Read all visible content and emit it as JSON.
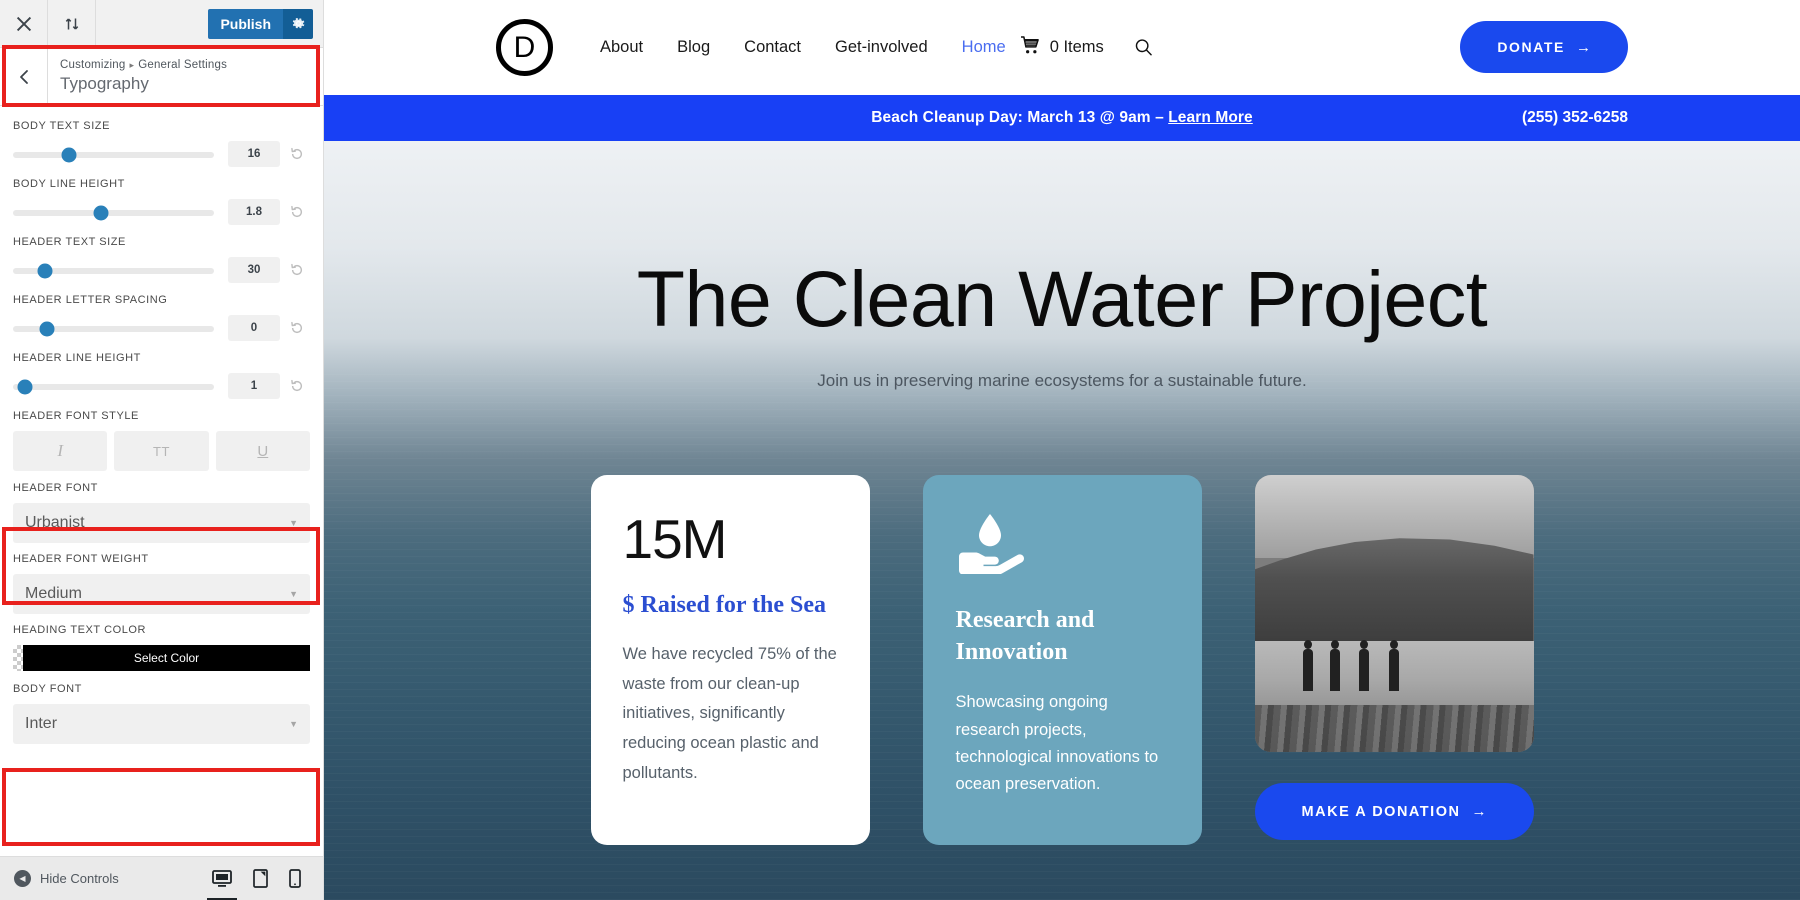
{
  "customizer": {
    "topbar": {
      "close_icon": "close-icon",
      "devices_icon": "collapse-expand-icon",
      "publish_label": "Publish",
      "gear_icon": "gear-icon"
    },
    "panel": {
      "back_icon": "chevron-left-icon",
      "breadcrumb_root": "Customizing",
      "breadcrumb_sep": "▸",
      "breadcrumb_parent": "General Settings",
      "title": "Typography"
    },
    "sliders": [
      {
        "label": "Body Text Size",
        "value": "16",
        "percent": 28
      },
      {
        "label": "Body Line Height",
        "value": "1.8",
        "percent": 44
      },
      {
        "label": "Header Text Size",
        "value": "30",
        "percent": 16
      },
      {
        "label": "Header Letter Spacing",
        "value": "0",
        "percent": 17
      },
      {
        "label": "Header Line Height",
        "value": "1",
        "percent": 6
      }
    ],
    "reset_icon": "reset-icon",
    "font_style": {
      "label": "Header Font Style",
      "buttons": [
        {
          "name": "italic-button",
          "glyph": "I"
        },
        {
          "name": "uppercase-button",
          "glyph": "TT"
        },
        {
          "name": "underline-button",
          "glyph": "U"
        }
      ]
    },
    "header_font": {
      "label": "Header Font",
      "value": "Urbanist"
    },
    "header_font_weight": {
      "label": "Header Font Weight",
      "value": "Medium"
    },
    "heading_text_color": {
      "label": "Heading Text Color",
      "button_label": "Select Color",
      "swatch": "#000000"
    },
    "body_font": {
      "label": "Body Font",
      "value": "Inter"
    },
    "footer": {
      "hide_controls": "Hide Controls",
      "devices": [
        {
          "name": "desktop-preview-button",
          "active": true
        },
        {
          "name": "tablet-preview-button",
          "active": false
        },
        {
          "name": "mobile-preview-button",
          "active": false
        }
      ]
    },
    "accent_color": "#2271b1",
    "annotation_color": "#e8211d"
  },
  "preview": {
    "nav": {
      "logo_letter": "D",
      "links": [
        {
          "label": "About",
          "current": false
        },
        {
          "label": "Blog",
          "current": false
        },
        {
          "label": "Contact",
          "current": false
        },
        {
          "label": "Get-involved",
          "current": false
        },
        {
          "label": "Home",
          "current": true
        }
      ],
      "cart_icon": "shopping-cart-icon",
      "cart_label": "0 Items",
      "search_icon": "search-icon",
      "donate_label": "DONATE",
      "donate_arrow": "→",
      "donate_color": "#1a49ee"
    },
    "announcement": {
      "text": "Beach Cleanup Day: March 13 @ 9am – ",
      "link": "Learn More",
      "phone": "(255) 352-6258",
      "bg": "#1840f5"
    },
    "hero": {
      "title": "The Clean Water Project",
      "subtitle": "Join us in preserving marine ecosystems for a sustainable future."
    },
    "cards": [
      {
        "type": "stat",
        "stat": "15M",
        "title": "$ Raised for the Sea",
        "body": "We have recycled 75% of the waste from our clean-up initiatives, significantly reducing ocean plastic and pollutants.",
        "title_color": "#2b4ed1"
      },
      {
        "type": "feature",
        "icon": "hand-holding-water-drop-icon",
        "title": "Research and Innovation",
        "body": "Showcasing ongoing research projects, technological innovations to ocean preservation.",
        "bg": "#6ca6bd"
      },
      {
        "type": "photo",
        "image_alt": "black-and-white-beach-photo",
        "button_label": "MAKE A DONATION",
        "button_arrow": "→"
      }
    ]
  }
}
